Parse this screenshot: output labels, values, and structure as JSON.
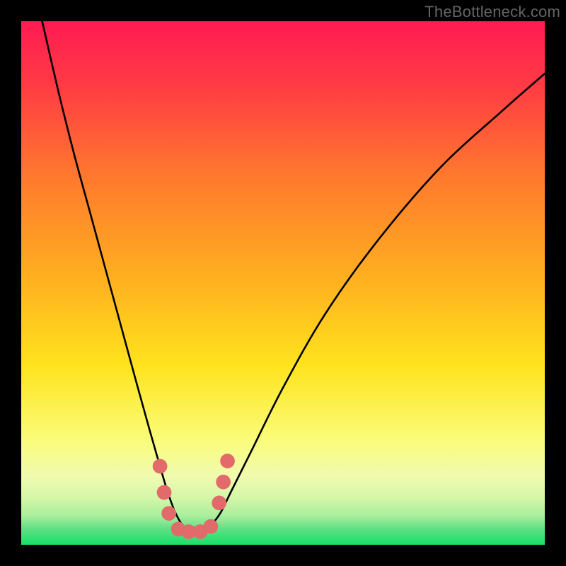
{
  "watermark": "TheBottleneck.com",
  "chart_data": {
    "type": "line",
    "title": "",
    "xlabel": "",
    "ylabel": "",
    "xlim": [
      0,
      100
    ],
    "ylim": [
      0,
      100
    ],
    "gradient_stops": [
      {
        "offset": 0,
        "color": "#ff1b52"
      },
      {
        "offset": 0.12,
        "color": "#ff3a44"
      },
      {
        "offset": 0.3,
        "color": "#ff7a2d"
      },
      {
        "offset": 0.5,
        "color": "#ffb21f"
      },
      {
        "offset": 0.66,
        "color": "#ffe41e"
      },
      {
        "offset": 0.8,
        "color": "#fafc7a"
      },
      {
        "offset": 0.87,
        "color": "#f0fbb0"
      },
      {
        "offset": 0.91,
        "color": "#d4f7a8"
      },
      {
        "offset": 0.945,
        "color": "#a9ef9c"
      },
      {
        "offset": 0.97,
        "color": "#5fdf85"
      },
      {
        "offset": 1.0,
        "color": "#17e169"
      }
    ],
    "series": [
      {
        "name": "bottleneck-curve",
        "x": [
          4,
          7,
          10,
          13,
          16,
          19,
          22,
          24.5,
          26.5,
          28,
          29.5,
          31,
          32.5,
          34.5,
          36,
          38,
          40,
          44,
          50,
          58,
          68,
          80,
          92,
          100
        ],
        "values": [
          100,
          87,
          75,
          64,
          53,
          42,
          31,
          22,
          15,
          10,
          6,
          3.5,
          2.5,
          2.5,
          3.5,
          6,
          10,
          18,
          30,
          44,
          58,
          72,
          83,
          90
        ]
      }
    ],
    "markers": {
      "name": "highlight-points",
      "points": [
        {
          "x": 26.5,
          "y": 15
        },
        {
          "x": 27.3,
          "y": 10
        },
        {
          "x": 28.2,
          "y": 6
        },
        {
          "x": 30.0,
          "y": 3
        },
        {
          "x": 32.0,
          "y": 2.5
        },
        {
          "x": 34.2,
          "y": 2.5
        },
        {
          "x": 36.2,
          "y": 3.5
        },
        {
          "x": 37.8,
          "y": 8
        },
        {
          "x": 38.6,
          "y": 12
        },
        {
          "x": 39.4,
          "y": 16
        }
      ],
      "color": "#e26a6a",
      "radius_data_units": 1.4
    }
  }
}
